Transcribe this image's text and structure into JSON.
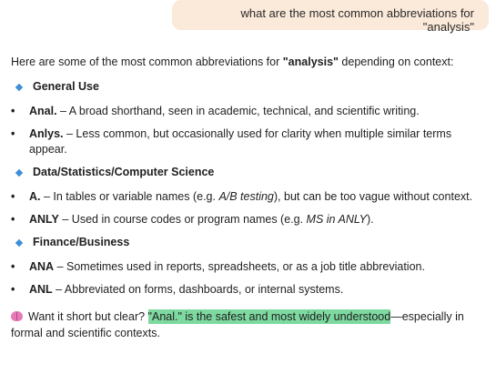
{
  "user_message": "what are the most common abbreviations for \"analysis\"",
  "intro": {
    "before": "Here are some of the most common abbreviations for ",
    "bold": "\"analysis\"",
    "after": " depending on context:"
  },
  "sections": [
    {
      "title": "General Use",
      "items": [
        {
          "term": "Anal.",
          "text": " – A broad shorthand, seen in academic, technical, and scientific writing."
        },
        {
          "term": "Anlys.",
          "text": " – Less common, but occasionally used for clarity when multiple similar terms appear."
        }
      ]
    },
    {
      "title": "Data/Statistics/Computer Science",
      "items": [
        {
          "term": "A.",
          "text_before": " – In tables or variable names (e.g. ",
          "italic": "A/B testing",
          "text_after": "), but can be too vague without context."
        },
        {
          "term": "ANLY",
          "text_before": " – Used in course codes or program names (e.g. ",
          "italic": "MS in ANLY",
          "text_after": ")."
        }
      ]
    },
    {
      "title": "Finance/Business",
      "items": [
        {
          "term": "ANA",
          "text": " – Sometimes used in reports, spreadsheets, or as a job title abbreviation."
        },
        {
          "term": "ANL",
          "text": " – Abbreviated on forms, dashboards, or internal systems."
        }
      ]
    }
  ],
  "closing": {
    "icon": "brain-icon",
    "before": "Want it short but clear? ",
    "highlight": "\"Anal.\" is the safest and most widely understood",
    "after": "—especially in formal and scientific contexts."
  },
  "colors": {
    "user_bubble": "#fbe9d9",
    "diamond": "#3f8fd8",
    "highlight": "#7ed9a0"
  }
}
